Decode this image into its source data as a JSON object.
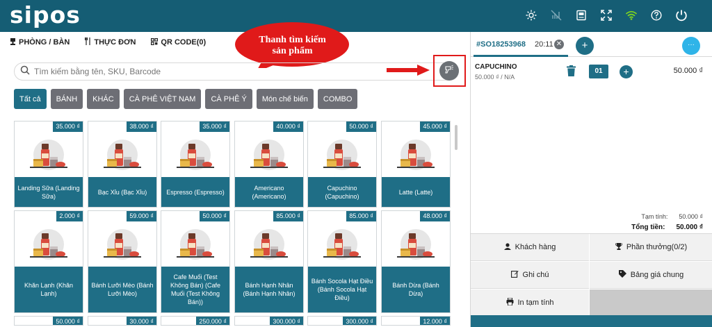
{
  "brand": {
    "logo": "sipos"
  },
  "topbar_icons": [
    "brightness-icon",
    "no-network-icon",
    "receipt-icon",
    "fullscreen-icon",
    "wifi-icon",
    "help-icon",
    "power-icon"
  ],
  "nav": {
    "rooms": "PHÒNG / BÀN",
    "menu": "THỰC ĐƠN",
    "qr": "QR CODE(0)"
  },
  "search": {
    "placeholder": "Tìm kiếm bằng tên, SKU, Barcode"
  },
  "callout": {
    "line1": "Thanh tìm kiếm",
    "line2": "sản phẩm"
  },
  "categories": [
    "Tất cả",
    "BÁNH",
    "KHÁC",
    "CÀ PHÊ VIỆT NAM",
    "CÀ PHÊ Ý",
    "Món chế biến",
    "COMBO"
  ],
  "products_row1": [
    {
      "price": "35.000 ₫",
      "name": "Landing Sữa (Landing Sữa)"
    },
    {
      "price": "38.000 ₫",
      "name": "Bạc Xỉu (Bạc Xỉu)"
    },
    {
      "price": "35.000 ₫",
      "name": "Espresso (Espresso)"
    },
    {
      "price": "40.000 ₫",
      "name": "Americano (Americano)"
    },
    {
      "price": "50.000 ₫",
      "name": "Capuchino (Capuchino)"
    },
    {
      "price": "45.000 ₫",
      "name": "Latte (Latte)"
    }
  ],
  "products_row2": [
    {
      "price": "2.000 ₫",
      "name": "Khăn Lạnh (Khăn Lạnh)"
    },
    {
      "price": "59.000 ₫",
      "name": "Bánh Lưỡi Mèo (Bánh Lưỡi Mèo)"
    },
    {
      "price": "50.000 ₫",
      "name": "Cafe Muối (Test Không Bán) (Cafe Muối (Test Không Bán))"
    },
    {
      "price": "85.000 ₫",
      "name": "Bánh Hạnh Nhân (Bánh Hạnh Nhân)"
    },
    {
      "price": "85.000 ₫",
      "name": "Bánh Socola Hạt Điều (Bánh Socola Hạt Điều)"
    },
    {
      "price": "48.000 ₫",
      "name": "Bánh Dừa (Bánh Dừa)"
    }
  ],
  "products_row3_prices": [
    "50.000 ₫",
    "30.000 ₫",
    "250.000 ₫",
    "300.000 ₫",
    "300.000 ₫",
    "12.000 ₫"
  ],
  "order": {
    "id": "#SO18253968",
    "time": "20:11",
    "close": "✕",
    "add": "+",
    "more": "···",
    "item": {
      "name": "CAPUCHINO",
      "sub": "50.000 ₫ / N/A",
      "qty": "01",
      "total": "50.000 ₫"
    },
    "subtotal_label": "Tạm tính:",
    "subtotal_value": "50.000 ₫",
    "total_label": "Tổng tiền:",
    "total_value": "50.000 ₫"
  },
  "actions": {
    "customer": "Khách hàng",
    "reward": "Phần thưởng(0/2)",
    "note": "Ghi chú",
    "pricelist": "Bảng giá chung",
    "print": "In tạm tính"
  },
  "colors": {
    "primary": "#1f6e86",
    "topbar": "#155d74",
    "accent_blue": "#2fb4e8",
    "callout_red": "#e01a1a"
  }
}
